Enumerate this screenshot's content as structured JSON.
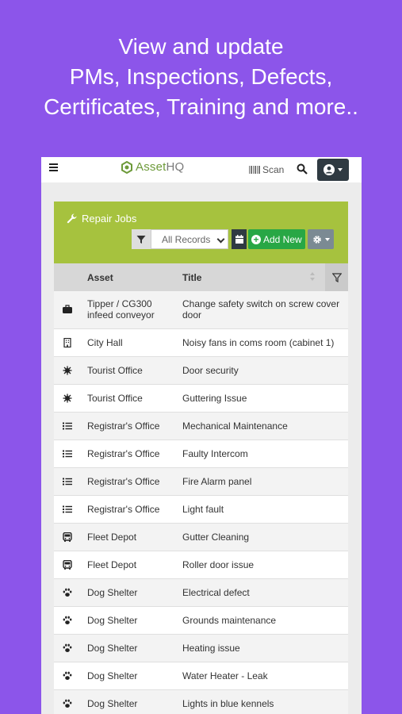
{
  "headline": {
    "line1": "View and update",
    "line2": "PMs, Inspections, Defects,",
    "line3": "Certificates, Training and more.."
  },
  "topbar": {
    "logo_prefix": "Asset",
    "logo_suffix": "HQ",
    "scan_label": "Scan"
  },
  "panel": {
    "title": "Repair Jobs",
    "filter_value": "All Records",
    "add_label": "Add New"
  },
  "table": {
    "columns": {
      "asset": "Asset",
      "title": "Title"
    },
    "rows": [
      {
        "icon": "truck-icon",
        "asset": "Tipper / CG300 infeed conveyor",
        "title": "Change safety switch on screw cover door",
        "tall": true
      },
      {
        "icon": "building-icon",
        "asset": "City Hall",
        "title": "Noisy fans in coms room (cabinet 1)"
      },
      {
        "icon": "virus-icon",
        "asset": "Tourist Office",
        "title": "Door security"
      },
      {
        "icon": "virus-icon",
        "asset": "Tourist Office",
        "title": "Guttering Issue"
      },
      {
        "icon": "list-icon",
        "asset": "Registrar's Office",
        "title": "Mechanical Maintenance"
      },
      {
        "icon": "list-icon",
        "asset": "Registrar's Office",
        "title": "Faulty Intercom"
      },
      {
        "icon": "list-icon",
        "asset": "Registrar's Office",
        "title": "Fire Alarm panel"
      },
      {
        "icon": "list-icon",
        "asset": "Registrar's Office",
        "title": "Light fault"
      },
      {
        "icon": "bus-icon",
        "asset": "Fleet Depot",
        "title": "Gutter Cleaning"
      },
      {
        "icon": "bus-icon",
        "asset": "Fleet Depot",
        "title": "Roller door issue"
      },
      {
        "icon": "paw-icon",
        "asset": "Dog Shelter",
        "title": "Electrical defect"
      },
      {
        "icon": "paw-icon",
        "asset": "Dog Shelter",
        "title": "Grounds maintenance"
      },
      {
        "icon": "paw-icon",
        "asset": "Dog Shelter",
        "title": "Heating issue"
      },
      {
        "icon": "paw-icon",
        "asset": "Dog Shelter",
        "title": "Water Heater - Leak"
      },
      {
        "icon": "paw-icon",
        "asset": "Dog Shelter",
        "title": "Lights in blue kennels"
      }
    ]
  },
  "colors": {
    "background": "#8c55ea",
    "panel_header": "#a6c23e",
    "add_button": "#28a745",
    "dark_button": "#2f3a42"
  }
}
